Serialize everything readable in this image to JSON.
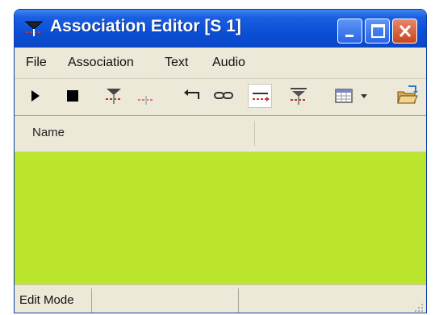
{
  "window": {
    "title": "Association Editor [S 1]",
    "buttons": {
      "minimize": "minimize",
      "maximize": "maximize",
      "close": "close"
    }
  },
  "menubar": {
    "items": [
      "File",
      "Association",
      "Text",
      "Audio"
    ]
  },
  "toolbar": {
    "tools": [
      {
        "name": "play-icon"
      },
      {
        "name": "stop-icon"
      },
      {
        "name": "association-icon"
      },
      {
        "name": "split-association-icon"
      },
      {
        "name": "undo-icon"
      },
      {
        "name": "link-icon"
      },
      {
        "name": "edit-mode-icon",
        "active": true
      },
      {
        "name": "merge-association-icon"
      },
      {
        "name": "grid-icon"
      },
      {
        "name": "dropdown-arrow-icon"
      },
      {
        "name": "open-folder-icon"
      }
    ]
  },
  "list": {
    "columns": [
      "Name"
    ],
    "rows": [],
    "background_color": "#bbe62d"
  },
  "statusbar": {
    "mode": "Edit Mode"
  },
  "colors": {
    "titlebar": "#0b4fd6",
    "chrome": "#ece9d8",
    "list_bg": "#bbe62d",
    "close_button": "#c8461e"
  }
}
